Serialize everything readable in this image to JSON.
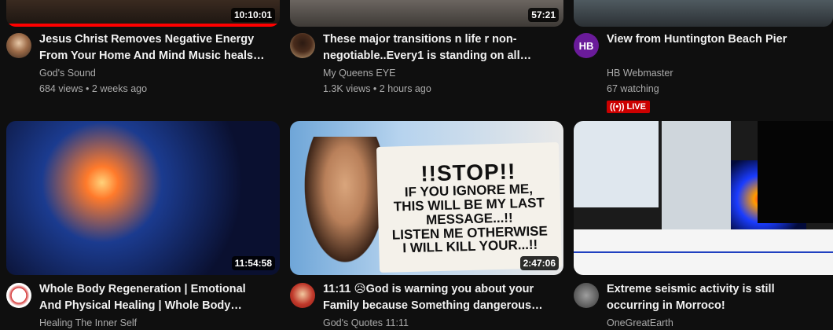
{
  "videos": [
    {
      "title": "Jesus Christ Removes Negative Energy From Your Home And Mind Music heals the soul...",
      "channel": "God's Sound",
      "stats": "684 views • 2 weeks ago",
      "duration": "10:10:01",
      "avatar_text": ""
    },
    {
      "title": "These major transitions n life r non-negotiable..Every1 is standing on all action...",
      "channel": "My Queens EYE",
      "stats": "1.3K views • 2 hours ago",
      "duration": "57:21",
      "avatar_text": ""
    },
    {
      "title": "View from Huntington Beach Pier",
      "channel": "HB Webmaster",
      "stats": "67 watching",
      "live_label": "LIVE",
      "avatar_text": "HB"
    },
    {
      "title": "Whole Body Regeneration | Emotional And Physical Healing | Whole Body Healing,...",
      "channel": "Healing The Inner Self",
      "duration": "11:54:58",
      "avatar_text": ""
    },
    {
      "title": "11:11 😥God is warning you about your Family because Something dangerous is...",
      "channel": "God's Quotes 11:11",
      "duration": "2:47:06",
      "avatar_text": "",
      "thumb_text": [
        "!!STOP!!",
        "IF YOU IGNORE ME,",
        "THIS WILL BE MY LAST",
        "MESSAGE...!!",
        "LISTEN ME OTHERWISE",
        "I WILL KILL YOUR...!!"
      ]
    },
    {
      "title": "Extreme seismic activity is still occurring in Morroco!",
      "channel": "OneGreatEarth",
      "avatar_text": ""
    }
  ],
  "colors": {
    "background": "#0f0f0f",
    "progress": "#ff0000",
    "live": "#cc0000",
    "hb_avatar": "#6a1b9a"
  }
}
